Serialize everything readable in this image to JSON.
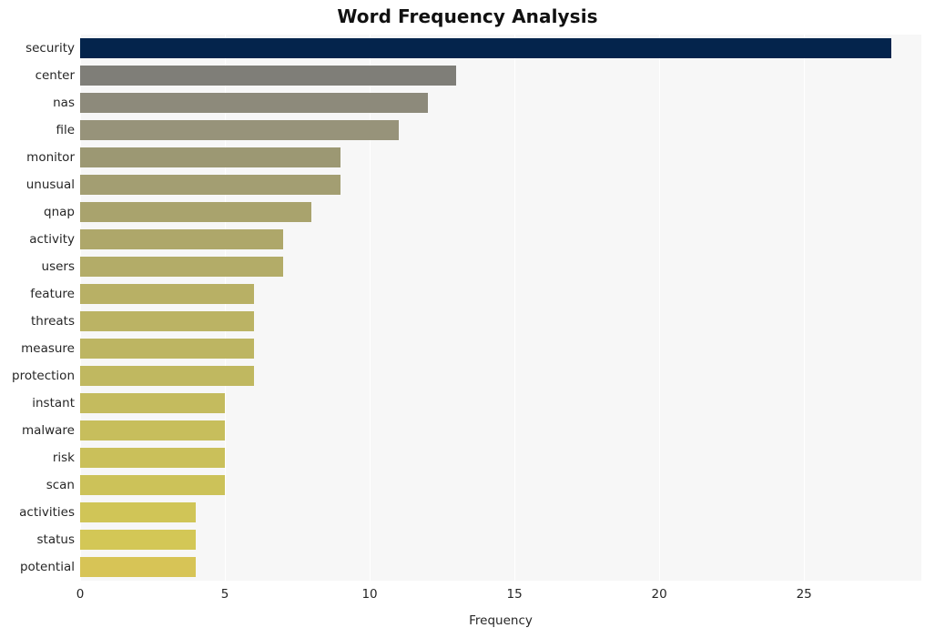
{
  "chart_data": {
    "type": "bar",
    "orientation": "horizontal",
    "title": "Word Frequency Analysis",
    "xlabel": "Frequency",
    "ylabel": "",
    "categories": [
      "security",
      "center",
      "nas",
      "file",
      "monitor",
      "unusual",
      "qnap",
      "activity",
      "users",
      "feature",
      "threats",
      "measure",
      "protection",
      "instant",
      "malware",
      "risk",
      "scan",
      "activities",
      "status",
      "potential"
    ],
    "values": [
      28,
      13,
      12,
      11,
      9,
      9,
      8,
      7,
      7,
      6,
      6,
      6,
      6,
      5,
      5,
      5,
      5,
      4,
      4,
      4
    ],
    "bar_colors": [
      "#04244c",
      "#7f7e78",
      "#8d8a7b",
      "#97937a",
      "#9c9873",
      "#a39e72",
      "#a9a36d",
      "#aea76a",
      "#b3ac68",
      "#b8b065",
      "#bbb364",
      "#bdb562",
      "#c0b860",
      "#c4bb5e",
      "#c7be5c",
      "#cac05a",
      "#ccc259",
      "#d0c557",
      "#d3c756",
      "#d7c456"
    ],
    "xticks": [
      0,
      5,
      10,
      15,
      20,
      25
    ],
    "xlim": [
      0,
      29.05
    ],
    "grid": true,
    "grid_axis": "x",
    "grid_color": "#ffffff",
    "plot_background": "#f7f7f7",
    "figure_background": "#ffffff",
    "legend": null
  }
}
